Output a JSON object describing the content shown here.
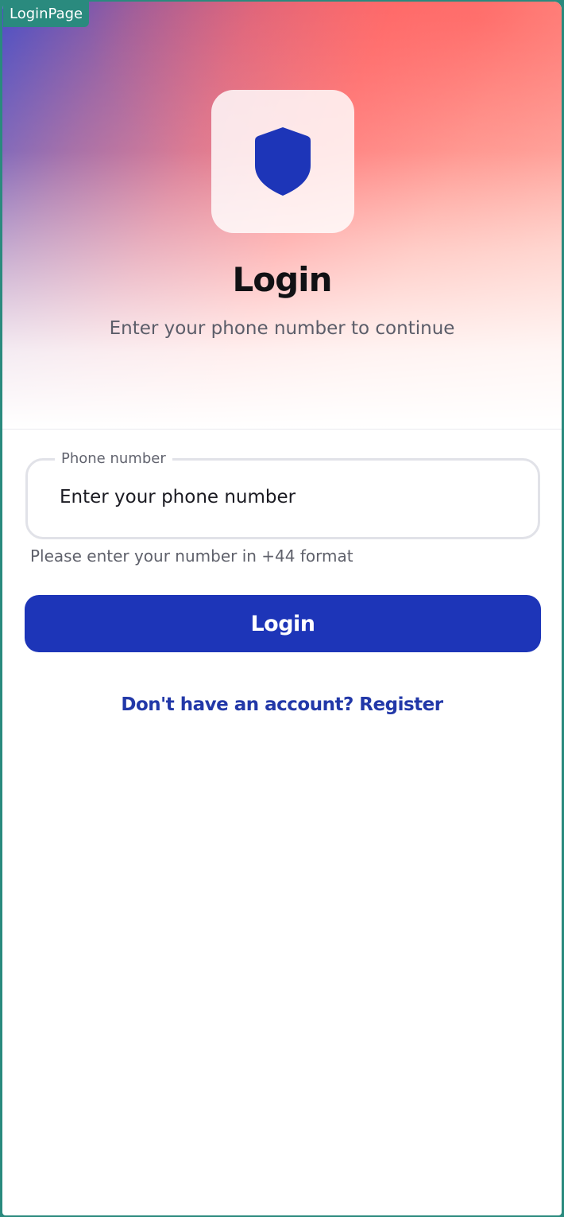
{
  "page_label": "LoginPage",
  "header": {
    "icon": "shield-icon",
    "title": "Login",
    "subtitle": "Enter your phone number to continue"
  },
  "form": {
    "phone_label": "Phone number",
    "phone_value": "",
    "phone_placeholder": "Enter your phone number",
    "helper_text": "Please enter your number in +44 format",
    "login_button_label": "Login"
  },
  "footer": {
    "register_link_text": "Don't have an account? Register"
  },
  "colors": {
    "primary": "#1d35b8",
    "link": "#2238a8",
    "frame_border": "#2a8a7e",
    "shield": "#1d35b8"
  }
}
